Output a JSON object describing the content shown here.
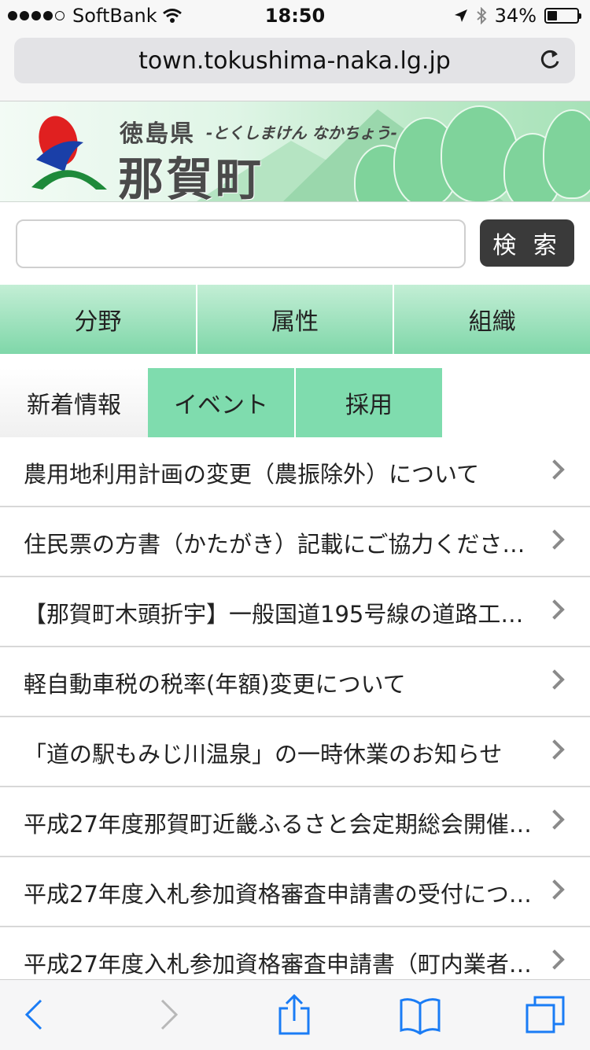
{
  "status": {
    "carrier": "SoftBank",
    "time": "18:50",
    "battery_label": "34%",
    "battery_level": 0.34
  },
  "browser": {
    "url": "town.tokushima-naka.lg.jp"
  },
  "header": {
    "prefecture": "徳島県",
    "kana": "-とくしまけん なかちょう-",
    "town": "那賀町"
  },
  "search": {
    "placeholder": "",
    "value": "",
    "button_label": "検 索"
  },
  "categories": [
    {
      "label": "分野"
    },
    {
      "label": "属性"
    },
    {
      "label": "組織"
    }
  ],
  "news_tabs": [
    {
      "label": "新着情報",
      "active": true
    },
    {
      "label": "イベント",
      "active": false
    },
    {
      "label": "採用",
      "active": false
    }
  ],
  "news": [
    {
      "title": "農用地利用計画の変更（農振除外）について"
    },
    {
      "title": "住民票の方書（かたがき）記載にご協力くださ…"
    },
    {
      "title": "【那賀町木頭折宇】一般国道195号線の道路工…"
    },
    {
      "title": "軽自動車税の税率(年額)変更について"
    },
    {
      "title": "「道の駅もみじ川温泉」の一時休業のお知らせ"
    },
    {
      "title": "平成27年度那賀町近畿ふるさと会定期総会開催…"
    },
    {
      "title": "平成27年度入札参加資格審査申請書の受付につ…"
    },
    {
      "title": "平成27年度入札参加資格審査申請書（町内業者…"
    }
  ],
  "colors": {
    "accent_green": "#7fdcae",
    "search_button": "#3a3a3a",
    "ios_blue": "#1a7cf5"
  }
}
